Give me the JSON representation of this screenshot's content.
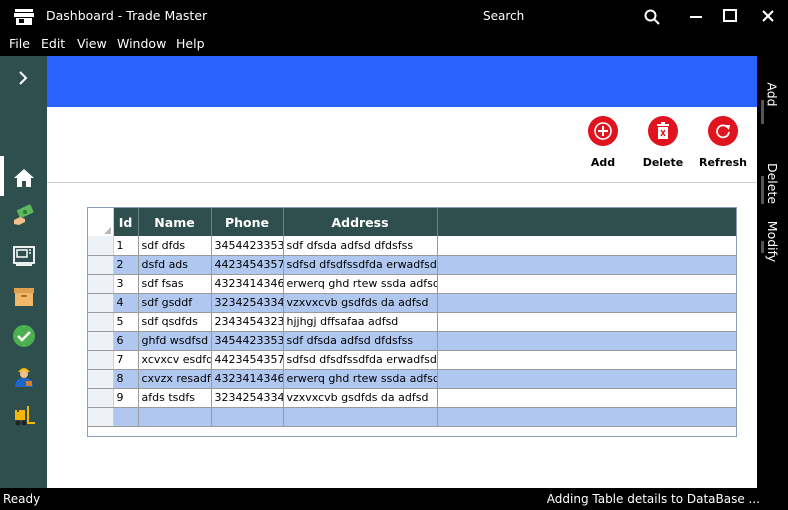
{
  "window": {
    "title": "Dashboard - Trade Master",
    "search_label": "Search"
  },
  "menu": {
    "items": [
      "File",
      "Edit",
      "View",
      "Window",
      "Help"
    ]
  },
  "sidebar": {
    "icons": [
      "home-icon",
      "money-icon",
      "machine-icon",
      "box-icon",
      "check-icon",
      "worker-icon",
      "forklift-icon"
    ]
  },
  "toolbar": {
    "add_label": "Add",
    "delete_label": "Delete",
    "refresh_label": "Refresh"
  },
  "right_tabs": {
    "add": "Add",
    "delete": "Delete",
    "modify": "Modify"
  },
  "table": {
    "columns": [
      "Id",
      "Name",
      "Phone",
      "Address"
    ],
    "rows": [
      [
        "1",
        "sdf dfds",
        "3454423353",
        "sdf dfsda adfsd dfdsfss"
      ],
      [
        "2",
        "dsfd ads",
        "4423454357",
        "sdfsd dfsdfssdfda erwadfsd"
      ],
      [
        "3",
        "sdf fsas",
        "4323414346",
        "erwerq ghd rtew ssda adfsd"
      ],
      [
        "4",
        "sdf gsddf",
        "3234254334",
        "vzxvxcvb gsdfds da adfsd"
      ],
      [
        "5",
        "sdf qsdfds",
        "2343454323",
        "hjjhgj dffsafaa adfsd"
      ],
      [
        "6",
        "ghfd wsdfsd",
        "3454423353",
        "sdf dfsda adfsd dfdsfss"
      ],
      [
        "7",
        "xcvxcv esdfd",
        "4423454357",
        "sdfsd dfsdfssdfda erwadfsd"
      ],
      [
        "8",
        "cxvzx resadf",
        "4323414346",
        "erwerq ghd rtew ssda adfsd"
      ],
      [
        "9",
        "afds tsdfs",
        "3234254334",
        "vzxvxcvb gsdfds da adfsd"
      ]
    ]
  },
  "status": {
    "left": "Ready",
    "right": "Adding Table details to DataBase ..."
  },
  "colors": {
    "banner": "#2962ff",
    "sidebar": "#2f4f4f",
    "accent_red": "#e0141e",
    "row_alt": "#b0c8f0"
  }
}
